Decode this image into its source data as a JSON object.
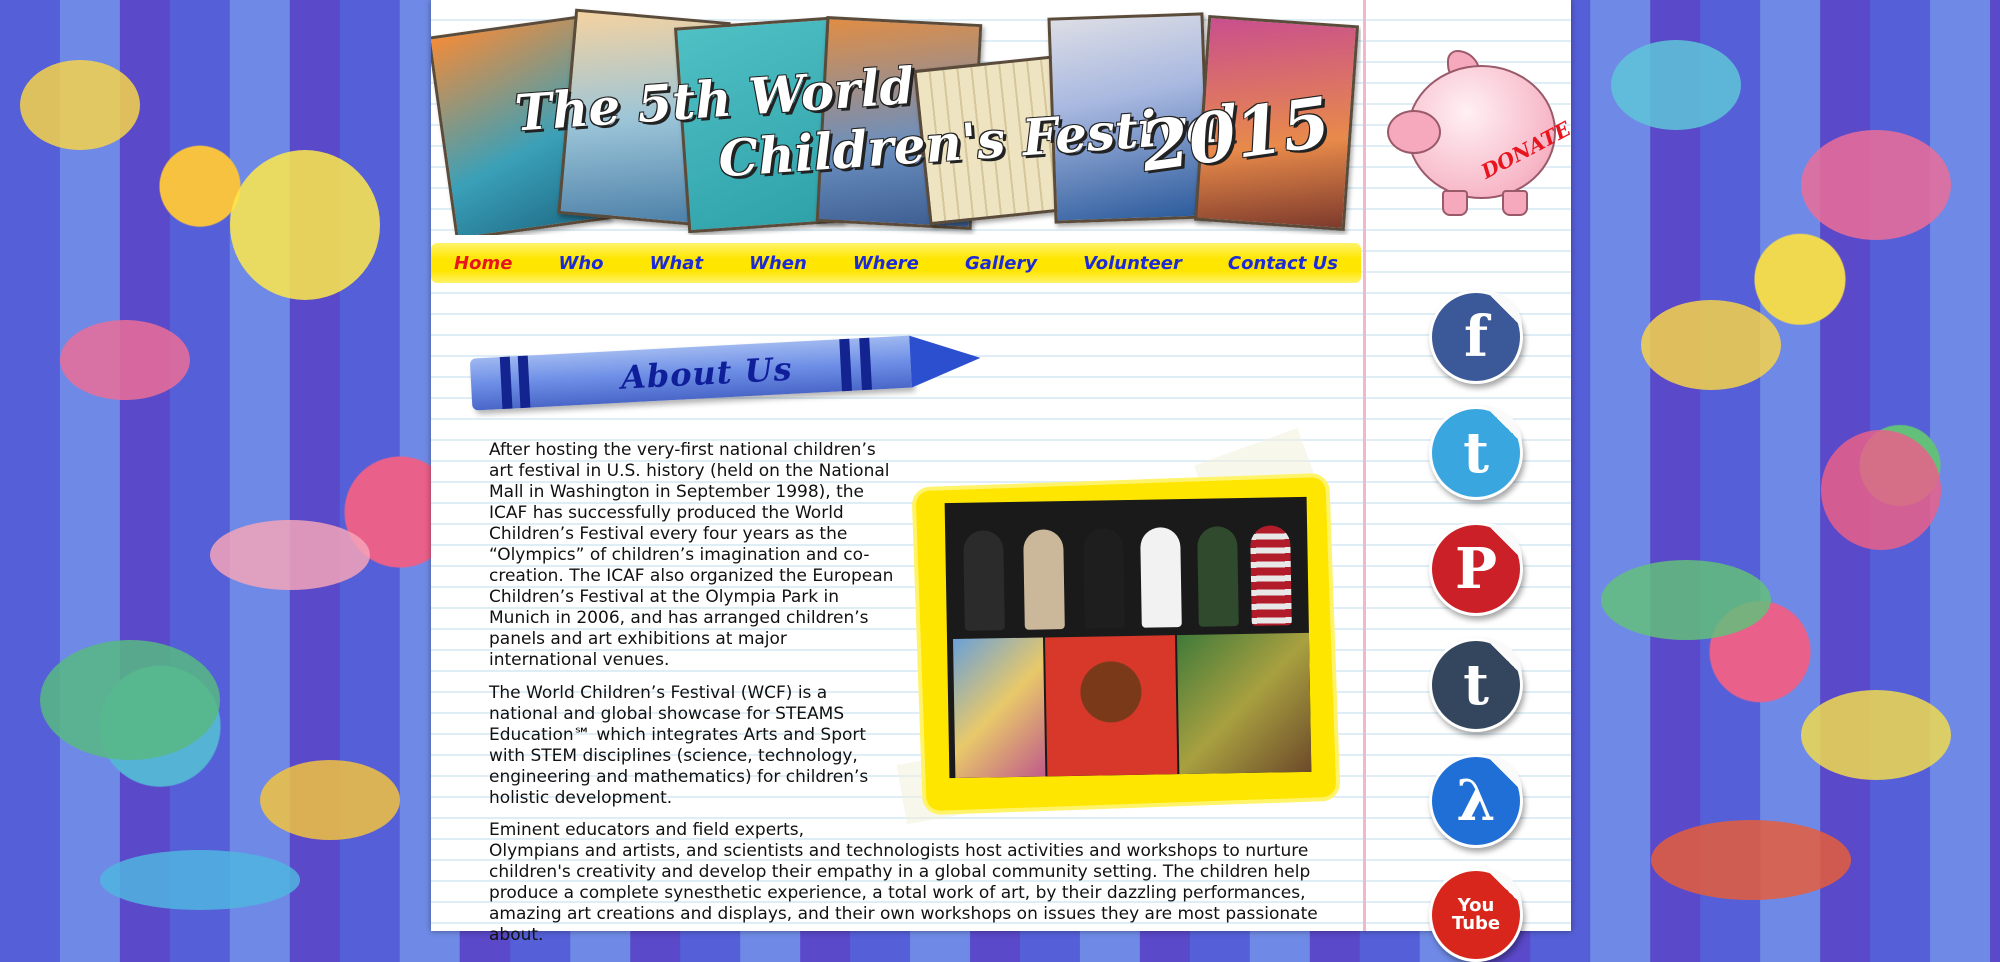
{
  "banner": {
    "title_line1": "The 5th World",
    "title_line2": "Children's Festival",
    "year": "2015"
  },
  "nav": {
    "items": [
      "Home",
      "Who",
      "What",
      "When",
      "Where",
      "Gallery",
      "Volunteer",
      "Contact Us"
    ],
    "active": "Home"
  },
  "section": {
    "heading": "About Us"
  },
  "content": {
    "p1": "After hosting the very-first national children’s art festival in U.S. history (held on the National Mall in Washington in September 1998), the ICAF has successfully produced the World Children’s Festival every four years as the “Olympics” of children’s imagination and co-creation. The ICAF also organized the European Children’s Festival at the Olympia Park in Munich in 2006, and has arranged children’s panels and art exhibitions at major international venues.",
    "p2": "The World Children’s Festival (WCF) is a national and global showcase for STEAMS Education℠ which integrates Arts and Sport with STEM disciplines (science, technology, engineering and mathematics) for children’s holistic development.",
    "p3a": "Eminent educators and field experts,",
    "p3b": "Olympians and artists, and scientists and technologists host activities and workshops to nurture children's creativity and develop their empathy in a global community setting. The children help produce a complete synesthetic experience, a total work of art, by their dazzling performances, amazing art creations and displays, and their own workshops on issues they are most passionate about."
  },
  "sidebar": {
    "donate_label": "DONATE",
    "social": [
      {
        "name": "facebook",
        "glyph": "f",
        "color": "#3b5998"
      },
      {
        "name": "twitter",
        "glyph": "t",
        "color": "#3aa6e0"
      },
      {
        "name": "pinterest",
        "glyph": "P",
        "color": "#cb2027"
      },
      {
        "name": "tumblr",
        "glyph": "t",
        "color": "#34465d"
      },
      {
        "name": "delicious",
        "glyph": "λ",
        "color": "#1f6fd6"
      },
      {
        "name": "youtube",
        "glyph": "You Tube",
        "color": "#d9261c"
      }
    ]
  },
  "colors": {
    "nav_bg": "#ffe600",
    "nav_link": "#1c2bd6",
    "nav_active": "#e8141e",
    "crayon": "#4a67c8"
  }
}
